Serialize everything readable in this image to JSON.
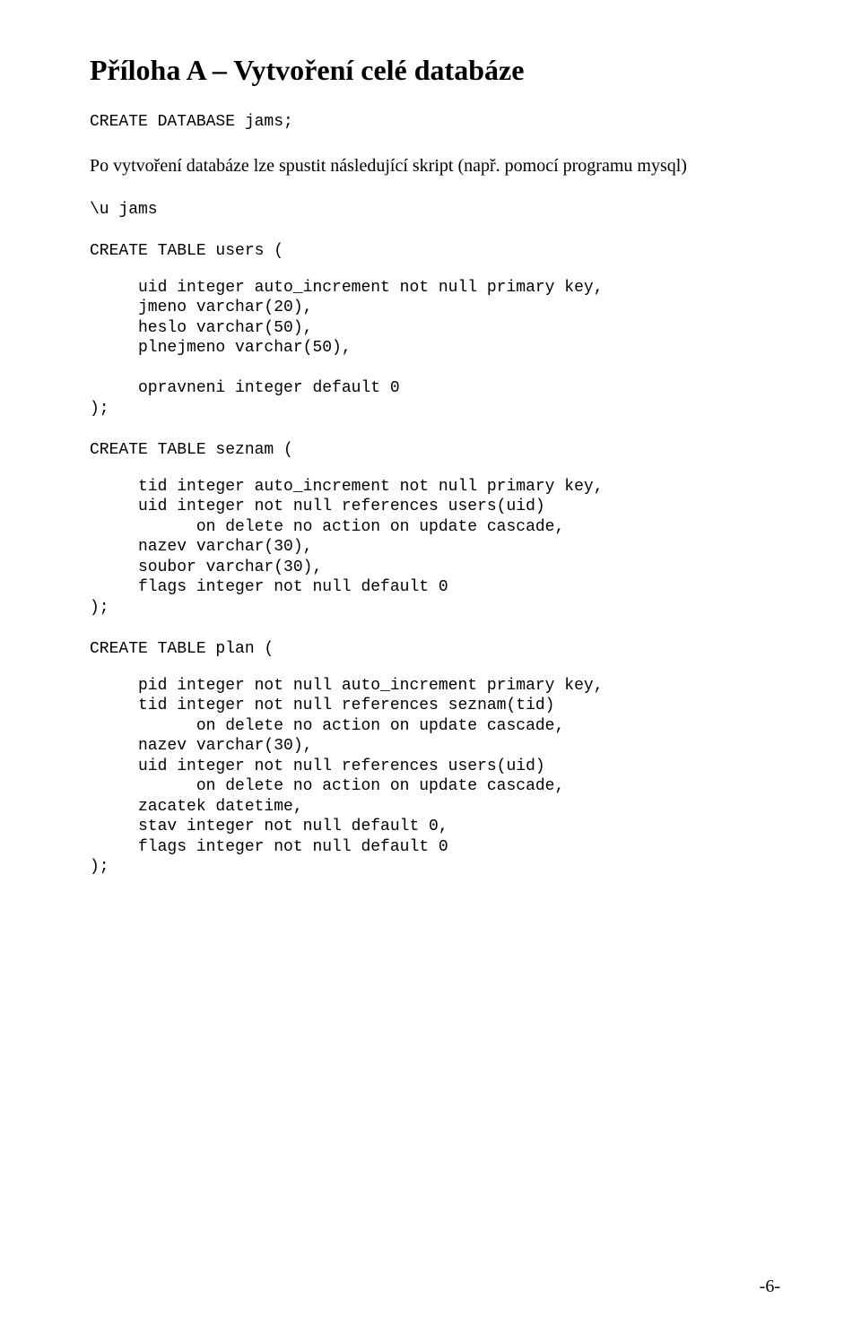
{
  "heading": "Příloha A – Vytvoření celé databáze",
  "line_create_db": "CREATE DATABASE jams;",
  "line_intro": "Po vytvoření databáze lze spustit následující skript (např. pomocí programu mysql)",
  "line_use": "\\u jams",
  "line_users_head": "CREATE TABLE users (",
  "block_users": "     uid integer auto_increment not null primary key,\n     jmeno varchar(20),\n     heslo varchar(50),\n     plnejmeno varchar(50),\n\n     opravneni integer default 0\n);",
  "line_seznam_head": "CREATE TABLE seznam (",
  "block_seznam": "     tid integer auto_increment not null primary key,\n     uid integer not null references users(uid)\n           on delete no action on update cascade,\n     nazev varchar(30),\n     soubor varchar(30),\n     flags integer not null default 0\n);",
  "line_plan_head": "CREATE TABLE plan (",
  "block_plan": "     pid integer not null auto_increment primary key,\n     tid integer not null references seznam(tid)\n           on delete no action on update cascade,\n     nazev varchar(30),\n     uid integer not null references users(uid)\n           on delete no action on update cascade,\n     zacatek datetime,\n     stav integer not null default 0,\n     flags integer not null default 0\n);",
  "page_number": "-6-"
}
